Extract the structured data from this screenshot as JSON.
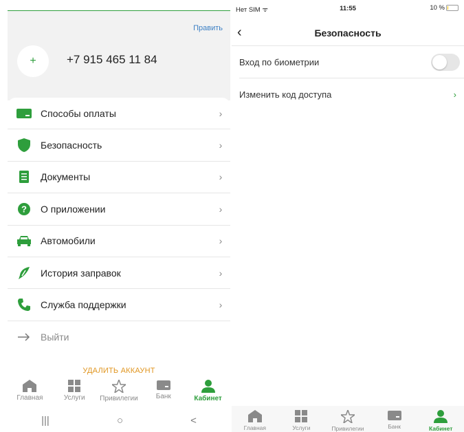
{
  "left": {
    "edit_label": "Править",
    "avatar_symbol": "+",
    "phone": "+7 915 465 11 84",
    "menu": [
      {
        "label": "Способы оплаты",
        "icon": "card-icon"
      },
      {
        "label": "Безопасность",
        "icon": "shield-icon"
      },
      {
        "label": "Документы",
        "icon": "document-icon"
      },
      {
        "label": "О приложении",
        "icon": "question-icon"
      },
      {
        "label": "Автомобили",
        "icon": "car-icon"
      },
      {
        "label": "История заправок",
        "icon": "fuel-nozzle-icon"
      },
      {
        "label": "Служба поддержки",
        "icon": "phone-icon"
      }
    ],
    "logout_label": "Выйти",
    "delete_label": "УДАЛИТЬ АККАУНТ",
    "tabs": [
      {
        "label": "Главная",
        "icon": "home-icon",
        "active": false
      },
      {
        "label": "Услуги",
        "icon": "grid-icon",
        "active": false
      },
      {
        "label": "Привилегии",
        "icon": "star-icon",
        "active": false
      },
      {
        "label": "Банк",
        "icon": "bank-card-icon",
        "active": false
      },
      {
        "label": "Кабинет",
        "icon": "user-icon",
        "active": true
      }
    ],
    "android_nav": [
      "|||",
      "○",
      "<"
    ]
  },
  "right": {
    "status": {
      "carrier": "Нет SIM",
      "time": "11:55",
      "battery": "10 %",
      "battery_level": 0.1
    },
    "title": "Безопасность",
    "rows": [
      {
        "label": "Вход по биометрии",
        "toggle_on": false
      },
      {
        "label": "Изменить код доступа"
      }
    ],
    "tabs": [
      {
        "label": "Главная",
        "icon": "home-icon",
        "active": false
      },
      {
        "label": "Услуги",
        "icon": "grid-icon",
        "active": false
      },
      {
        "label": "Привилегии",
        "icon": "star-icon",
        "active": false
      },
      {
        "label": "Банк",
        "icon": "bank-card-icon",
        "active": false
      },
      {
        "label": "Кабинет",
        "icon": "user-icon",
        "active": true
      }
    ]
  },
  "colors": {
    "accent": "#2e9e3c",
    "link": "#3b7fc4",
    "danger": "#e0951f",
    "muted": "#8a8a8a"
  }
}
